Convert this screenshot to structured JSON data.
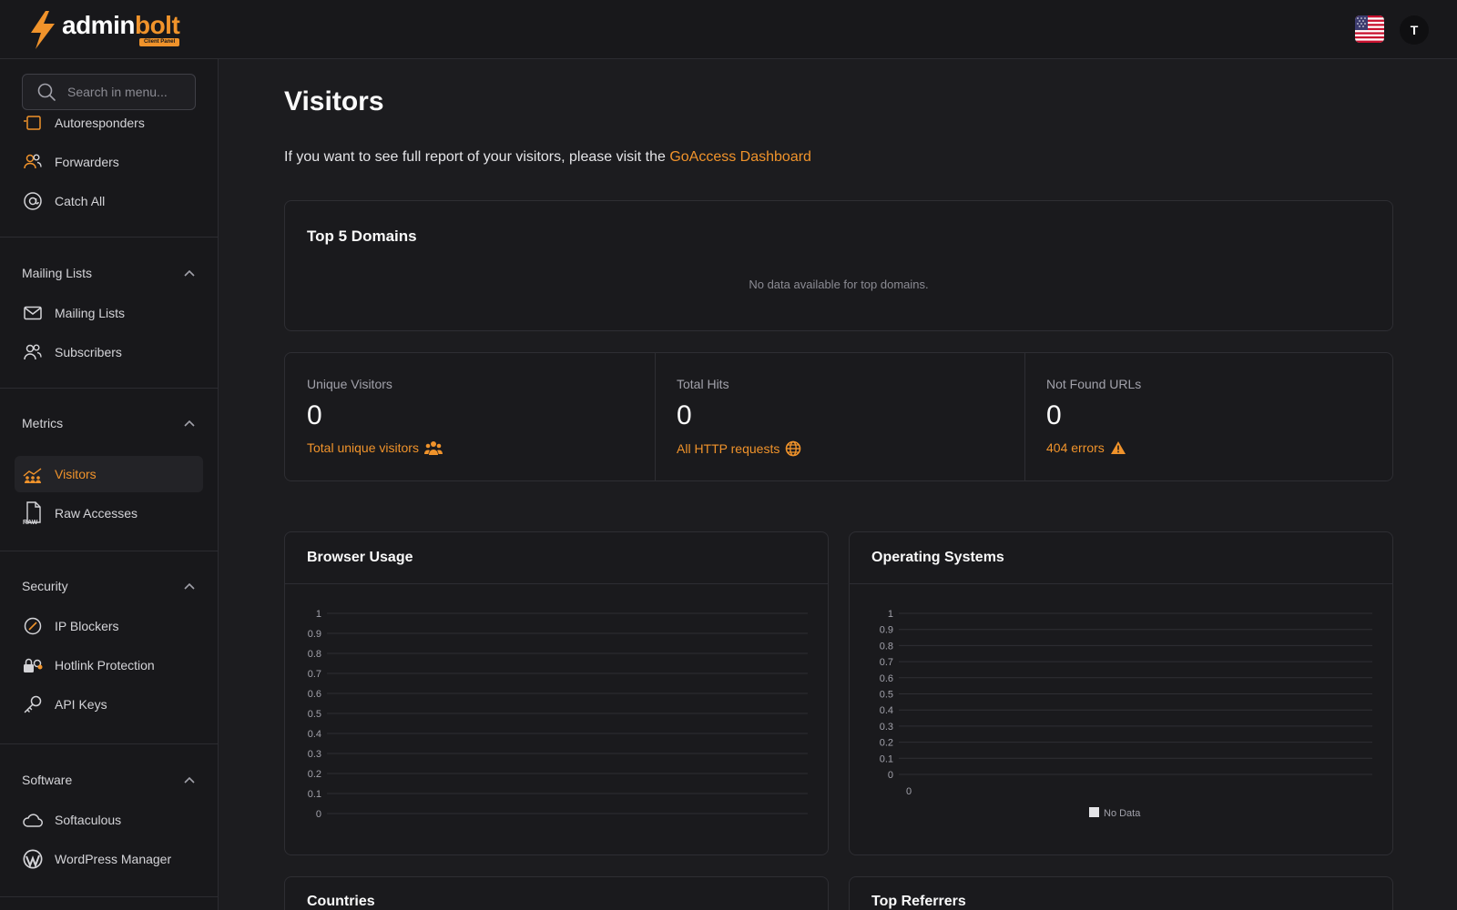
{
  "header": {
    "logo": {
      "part1": "admin",
      "part2": "bolt",
      "tag": "Client Panel"
    },
    "avatar_initial": "T",
    "icons": {
      "flag": "us-flag-icon"
    }
  },
  "sidebar": {
    "search_placeholder": "Search in menu...",
    "items_top": [
      {
        "label": "Autoresponders",
        "icon": "autoresponder-icon"
      },
      {
        "label": "Forwarders",
        "icon": "users-icon"
      },
      {
        "label": "Catch All",
        "icon": "at-sign-icon"
      }
    ],
    "sections": [
      {
        "title": "Mailing Lists",
        "items": [
          {
            "label": "Mailing Lists",
            "icon": "envelope-icon"
          },
          {
            "label": "Subscribers",
            "icon": "subscribers-icon"
          }
        ]
      },
      {
        "title": "Metrics",
        "items": [
          {
            "label": "Visitors",
            "icon": "visitors-icon",
            "active": true
          },
          {
            "label": "Raw Accesses",
            "icon": "raw-file-icon"
          }
        ]
      },
      {
        "title": "Security",
        "items": [
          {
            "label": "IP Blockers",
            "icon": "block-icon"
          },
          {
            "label": "Hotlink Protection",
            "icon": "hotlink-icon"
          },
          {
            "label": "API Keys",
            "icon": "key-icon"
          }
        ]
      },
      {
        "title": "Software",
        "items": [
          {
            "label": "Softaculous",
            "icon": "cloud-icon"
          },
          {
            "label": "WordPress Manager",
            "icon": "wordpress-icon"
          }
        ]
      }
    ]
  },
  "main": {
    "title": "Visitors",
    "intro_text": "If you want to see full report of your visitors, please visit the ",
    "intro_link": "GoAccess Dashboard",
    "top_domains": {
      "title": "Top 5 Domains",
      "empty": "No data available for top domains."
    },
    "stats": [
      {
        "label": "Unique Visitors",
        "value": "0",
        "footer": "Total unique visitors",
        "icon": "users-group-icon"
      },
      {
        "label": "Total Hits",
        "value": "0",
        "footer": "All HTTP requests",
        "icon": "globe-icon"
      },
      {
        "label": "Not Found URLs",
        "value": "0",
        "footer": "404 errors",
        "icon": "warning-icon"
      }
    ],
    "bottom_cards": {
      "countries": "Countries",
      "referrers": "Top Referrers"
    }
  },
  "colors": {
    "accent": "#f0932b",
    "background": "#1c1c1f",
    "sidebar": "#18181b"
  },
  "chart_data": [
    {
      "type": "bar",
      "title": "Browser Usage",
      "categories": [],
      "series": [],
      "yticks": [
        "1",
        "0.9",
        "0.8",
        "0.7",
        "0.6",
        "0.5",
        "0.4",
        "0.3",
        "0.2",
        "0.1",
        "0"
      ],
      "ylim": [
        0,
        1
      ],
      "grid": true
    },
    {
      "type": "bar",
      "title": "Operating Systems",
      "categories": [
        "0"
      ],
      "series": [
        {
          "name": "No Data",
          "values": []
        }
      ],
      "yticks": [
        "1",
        "0.9",
        "0.8",
        "0.7",
        "0.6",
        "0.5",
        "0.4",
        "0.3",
        "0.2",
        "0.1",
        "0"
      ],
      "xticks": [
        "0"
      ],
      "ylim": [
        0,
        1
      ],
      "legend": "bottom",
      "grid": true
    }
  ]
}
